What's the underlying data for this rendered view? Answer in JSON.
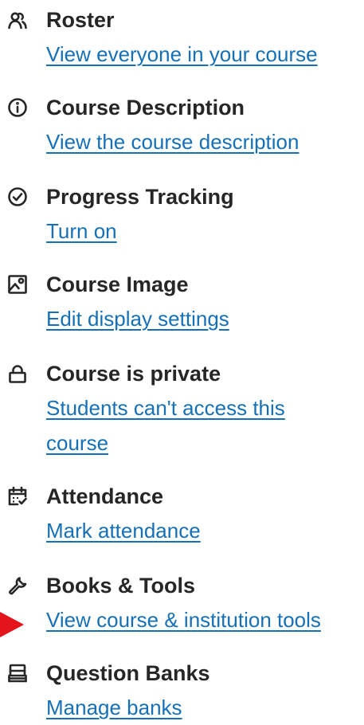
{
  "items": [
    {
      "icon": "roster-icon",
      "title": "Roster",
      "link": "View everyone in your course"
    },
    {
      "icon": "info-circle-icon",
      "title": "Course Description",
      "link": "View the course description"
    },
    {
      "icon": "check-circle-icon",
      "title": "Progress Tracking",
      "link": "Turn on"
    },
    {
      "icon": "image-icon",
      "title": "Course Image",
      "link": "Edit display settings"
    },
    {
      "icon": "lock-icon",
      "title": "Course is private",
      "link": "Students can't access this course"
    },
    {
      "icon": "calendar-check-icon",
      "title": "Attendance",
      "link": "Mark attendance"
    },
    {
      "icon": "wrench-icon",
      "title": "Books & Tools",
      "link": "View course & institution tools"
    },
    {
      "icon": "question-bank-icon",
      "title": "Question Banks",
      "link": "Manage banks"
    }
  ],
  "colors": {
    "link": "#1570b8",
    "title": "#262626",
    "pointer_arrow": "#e3141b"
  }
}
